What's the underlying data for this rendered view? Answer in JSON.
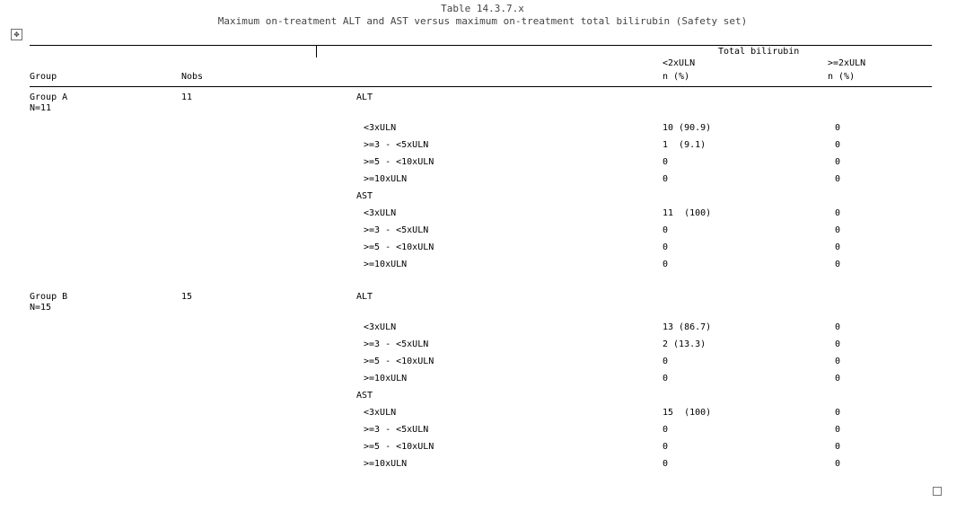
{
  "title": "Table 14.3.7.x",
  "subtitle": "Maximum on-treatment ALT and AST versus maximum on-treatment total bilirubin (Safety set)",
  "header": {
    "spanning": "Total bilirubin",
    "group": "Group",
    "nobs": "Nobs",
    "lt2_line1": "<2xULN",
    "lt2_line2": "n (%)",
    "ge2_line1": ">=2xULN",
    "ge2_line2": "n (%)"
  },
  "groups": [
    {
      "name": "Group A",
      "n_label": "N=11",
      "nobs": "11",
      "params": [
        {
          "label": "ALT",
          "rows": [
            {
              "cat": "<3xULN",
              "lt2": "10 (90.9)",
              "ge2": "0"
            },
            {
              "cat": ">=3 - <5xULN",
              "lt2": "1  (9.1)",
              "ge2": "0"
            },
            {
              "cat": ">=5 - <10xULN",
              "lt2": "0",
              "ge2": "0"
            },
            {
              "cat": ">=10xULN",
              "lt2": "0",
              "ge2": "0"
            }
          ]
        },
        {
          "label": "AST",
          "rows": [
            {
              "cat": "<3xULN",
              "lt2": "11  (100)",
              "ge2": "0"
            },
            {
              "cat": ">=3 - <5xULN",
              "lt2": "0",
              "ge2": "0"
            },
            {
              "cat": ">=5 - <10xULN",
              "lt2": "0",
              "ge2": "0"
            },
            {
              "cat": ">=10xULN",
              "lt2": "0",
              "ge2": "0"
            }
          ]
        }
      ]
    },
    {
      "name": "Group B",
      "n_label": "N=15",
      "nobs": "15",
      "params": [
        {
          "label": "ALT",
          "rows": [
            {
              "cat": "<3xULN",
              "lt2": "13 (86.7)",
              "ge2": "0"
            },
            {
              "cat": ">=3 - <5xULN",
              "lt2": "2 (13.3)",
              "ge2": "0"
            },
            {
              "cat": ">=5 - <10xULN",
              "lt2": "0",
              "ge2": "0"
            },
            {
              "cat": ">=10xULN",
              "lt2": "0",
              "ge2": "0"
            }
          ]
        },
        {
          "label": "AST",
          "rows": [
            {
              "cat": "<3xULN",
              "lt2": "15  (100)",
              "ge2": "0"
            },
            {
              "cat": ">=3 - <5xULN",
              "lt2": "0",
              "ge2": "0"
            },
            {
              "cat": ">=5 - <10xULN",
              "lt2": "0",
              "ge2": "0"
            },
            {
              "cat": ">=10xULN",
              "lt2": "0",
              "ge2": "0"
            }
          ]
        }
      ]
    }
  ]
}
